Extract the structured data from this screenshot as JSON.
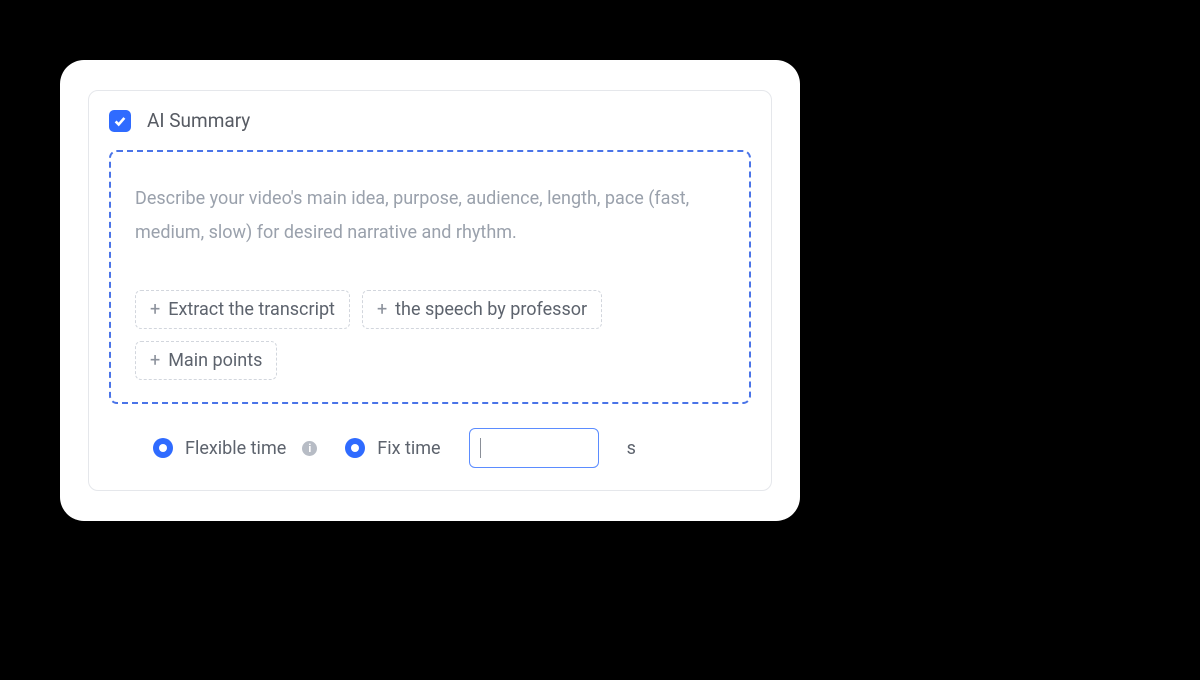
{
  "header": {
    "checked": true,
    "title": "AI Summary"
  },
  "textarea": {
    "placeholder": "Describe your video's main idea, purpose, audience, length, pace (fast, medium, slow) for desired narrative and rhythm."
  },
  "chips": [
    "Extract the transcript",
    "the speech by professor",
    "Main points"
  ],
  "options": {
    "flexible_label": "Flexible time",
    "fix_label": "Fix time",
    "fix_value": "",
    "unit": "s"
  }
}
